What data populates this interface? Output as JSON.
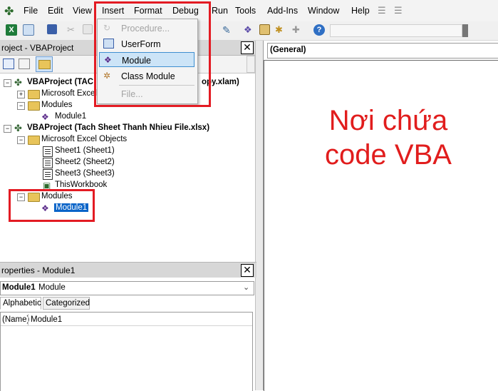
{
  "menubar": {
    "items": [
      "File",
      "Edit",
      "View",
      "Insert",
      "Format",
      "Debug",
      "Run",
      "Tools",
      "Add-Ins",
      "Window",
      "Help"
    ],
    "underline": [
      "F",
      "E",
      "V",
      "I",
      "o",
      "D",
      "R",
      "T",
      "A",
      "W",
      "H"
    ]
  },
  "insert_menu": {
    "items": [
      {
        "label": "Procedure...",
        "enabled": false,
        "icon": "procedure-icon"
      },
      {
        "label": "UserForm",
        "enabled": true,
        "icon": "userform-icon"
      },
      {
        "label": "Module",
        "enabled": true,
        "icon": "module-icon",
        "highlighted": true
      },
      {
        "label": "Class Module",
        "enabled": true,
        "icon": "class-module-icon"
      },
      {
        "label": "File...",
        "enabled": false,
        "icon": "file-icon"
      }
    ]
  },
  "project_explorer": {
    "title": "roject - VBAProject",
    "tree": {
      "project1_label": "VBAProject (TAC",
      "project1_suffix": "opy.xlam)",
      "project1_excel_objects": "Microsoft Excel",
      "project1_modules": "Modules",
      "project1_module1": "Module1",
      "project2_label": "VBAProject (Tach Sheet Thanh Nhieu File.xlsx)",
      "project2_excel_objects": "Microsoft Excel Objects",
      "sheet1": "Sheet1 (Sheet1)",
      "sheet2": "Sheet2 (Sheet2)",
      "sheet3": "Sheet3 (Sheet3)",
      "thisworkbook": "ThisWorkbook",
      "project2_modules": "Modules",
      "project2_module1": "Module1"
    }
  },
  "properties": {
    "title": "roperties - Module1",
    "combo_name": "Module1",
    "combo_type": "Module",
    "tabs": [
      "Alphabetic",
      "Categorized"
    ],
    "row_name": "(Name)",
    "row_value": "Module1"
  },
  "code_window": {
    "object_combo": "(General)",
    "annotation_line1": "Nơi chứa",
    "annotation_line2": "code VBA"
  },
  "colors": {
    "highlight_red": "#e31b23",
    "annotation_red": "#e11d1d",
    "selection_blue": "#0a64c8",
    "menu_hover": "#cce4f7"
  }
}
